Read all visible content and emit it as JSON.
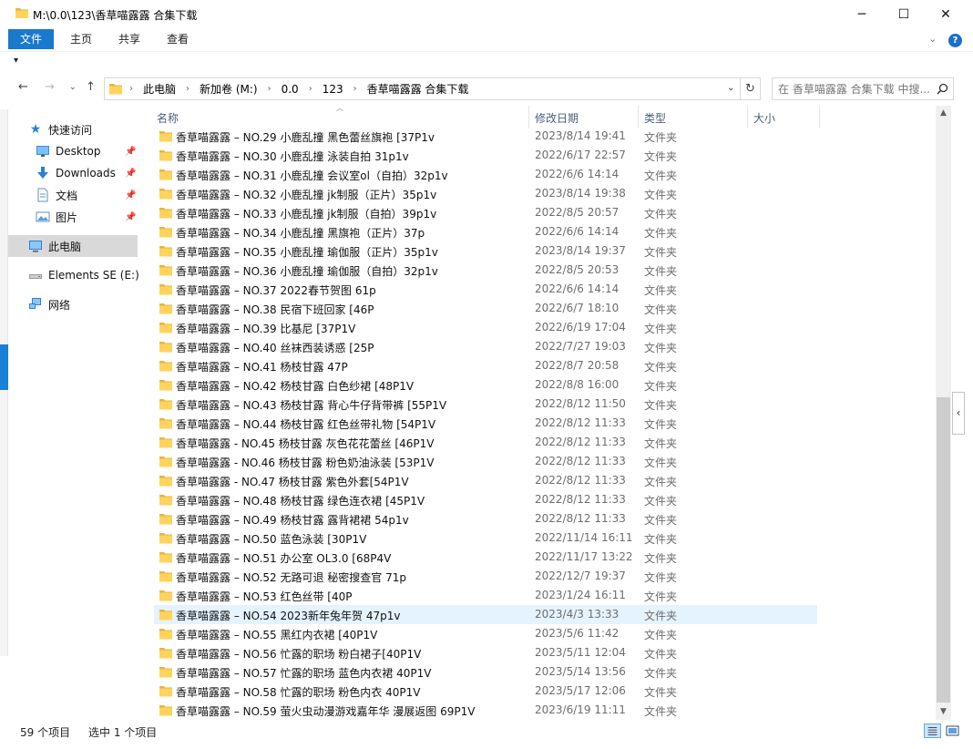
{
  "window": {
    "title": "M:\\0.0\\123\\香草喵露露 合集下载",
    "minimize_glyph": "─",
    "maximize_glyph": "☐",
    "close_glyph": "✕"
  },
  "ribbon": {
    "tabs": [
      {
        "label": "文件",
        "active": true
      },
      {
        "label": "主页",
        "active": false
      },
      {
        "label": "共享",
        "active": false
      },
      {
        "label": "查看",
        "active": false
      }
    ],
    "expand_glyph": "⌄",
    "help_glyph": "?"
  },
  "quick_access_glyph": "▾",
  "address": {
    "crumbs": [
      "此电脑",
      "新加卷 (M:)",
      "0.0",
      "123",
      "香草喵露露 合集下载"
    ],
    "separator": "›",
    "refresh_glyph": "↻",
    "dropdown_glyph": "⌄"
  },
  "search": {
    "placeholder": "在 香草喵露露 合集下载 中搜..."
  },
  "nav_buttons": {
    "back": "←",
    "forward": "→",
    "recent": "⌄",
    "up": "↑"
  },
  "nav_pane": {
    "pin_glyph": "📌",
    "items": [
      {
        "label": "快速访问",
        "icon": "star-icon",
        "indent": 0,
        "pinned": false
      },
      {
        "label": "Desktop",
        "icon": "desktop-icon",
        "indent": 1,
        "pinned": true
      },
      {
        "label": "Downloads",
        "icon": "download-icon",
        "indent": 1,
        "pinned": true
      },
      {
        "label": "文档",
        "icon": "document-icon",
        "indent": 1,
        "pinned": true
      },
      {
        "label": "图片",
        "icon": "picture-icon",
        "indent": 1,
        "pinned": true
      },
      {
        "label": "此电脑",
        "icon": "computer-icon",
        "indent": 0,
        "pinned": false,
        "selected": true
      },
      {
        "label": "Elements SE (E:)",
        "icon": "drive-icon",
        "indent": 0,
        "pinned": false
      },
      {
        "label": "网络",
        "icon": "network-icon",
        "indent": 0,
        "pinned": false
      }
    ]
  },
  "columns": {
    "name": "名称",
    "date": "修改日期",
    "type": "类型",
    "size": "大小"
  },
  "files": [
    {
      "name": "香草喵露露 – NO.29 小鹿乱撞 黑色蕾丝旗袍 [37P1v",
      "date": "2023/8/14 19:41",
      "type": "文件夹"
    },
    {
      "name": "香草喵露露 – NO.30 小鹿乱撞 泳装自拍 31p1v",
      "date": "2022/6/17 22:57",
      "type": "文件夹"
    },
    {
      "name": "香草喵露露 – NO.31 小鹿乱撞 会议室ol（自拍）32p1v",
      "date": "2022/6/6 14:14",
      "type": "文件夹"
    },
    {
      "name": "香草喵露露 – NO.32 小鹿乱撞 jk制服（正片）35p1v",
      "date": "2023/8/14 19:38",
      "type": "文件夹"
    },
    {
      "name": "香草喵露露 – NO.33 小鹿乱撞 jk制服（自拍）39p1v",
      "date": "2022/8/5 20:57",
      "type": "文件夹"
    },
    {
      "name": "香草喵露露 – NO.34 小鹿乱撞 黑旗袍（正片）37p",
      "date": "2022/6/6 14:14",
      "type": "文件夹"
    },
    {
      "name": "香草喵露露 – NO.35 小鹿乱撞 瑜伽服（正片）35p1v",
      "date": "2023/8/14 19:37",
      "type": "文件夹"
    },
    {
      "name": "香草喵露露 – NO.36 小鹿乱撞 瑜伽服（自拍）32p1v",
      "date": "2022/8/5 20:53",
      "type": "文件夹"
    },
    {
      "name": "香草喵露露 – NO.37 2022春节贺图 61p",
      "date": "2022/6/6 14:14",
      "type": "文件夹"
    },
    {
      "name": "香草喵露露 – NO.38 民宿下班回家 [46P",
      "date": "2022/6/7 18:10",
      "type": "文件夹"
    },
    {
      "name": "香草喵露露 – NO.39 比基尼 [37P1V",
      "date": "2022/6/19 17:04",
      "type": "文件夹"
    },
    {
      "name": "香草喵露露 – NO.40 丝袜西装诱惑 [25P",
      "date": "2022/7/27 19:03",
      "type": "文件夹"
    },
    {
      "name": "香草喵露露 – NO.41 杨枝甘露 47P",
      "date": "2022/8/7 20:58",
      "type": "文件夹"
    },
    {
      "name": "香草喵露露 – NO.42 杨枝甘露 白色纱裙 [48P1V",
      "date": "2022/8/8 16:00",
      "type": "文件夹"
    },
    {
      "name": "香草喵露露 – NO.43 杨枝甘露 背心牛仔背带裤 [55P1V",
      "date": "2022/8/12 11:50",
      "type": "文件夹"
    },
    {
      "name": "香草喵露露 – NO.44 杨枝甘露 红色丝带礼物 [54P1V",
      "date": "2022/8/12 11:33",
      "type": "文件夹"
    },
    {
      "name": "香草喵露露 - NO.45 杨枝甘露 灰色花花蕾丝 [46P1V",
      "date": "2022/8/12 11:33",
      "type": "文件夹"
    },
    {
      "name": "香草喵露露 - NO.46 杨枝甘露 粉色奶油泳装 [53P1V",
      "date": "2022/8/12 11:33",
      "type": "文件夹"
    },
    {
      "name": "香草喵露露 - NO.47 杨枝甘露 紫色外套[54P1V",
      "date": "2022/8/12 11:33",
      "type": "文件夹"
    },
    {
      "name": "香草喵露露 – NO.48 杨枝甘露 绿色连衣裙 [45P1V",
      "date": "2022/8/12 11:33",
      "type": "文件夹"
    },
    {
      "name": "香草喵露露 – NO.49 杨枝甘露 露背裙裙 54p1v",
      "date": "2022/8/12 11:33",
      "type": "文件夹"
    },
    {
      "name": "香草喵露露 – NO.50 蓝色泳装 [30P1V",
      "date": "2022/11/14 16:11",
      "type": "文件夹"
    },
    {
      "name": "香草喵露露 – NO.51 办公室 OL3.0 [68P4V",
      "date": "2022/11/17 13:22",
      "type": "文件夹"
    },
    {
      "name": "香草喵露露 – NO.52 无路可退 秘密搜查官 71p",
      "date": "2022/12/7 19:37",
      "type": "文件夹"
    },
    {
      "name": "香草喵露露 – NO.53 红色丝带 [40P",
      "date": "2023/1/24 16:11",
      "type": "文件夹"
    },
    {
      "name": "香草喵露露 – NO.54 2023新年兔年贺 47p1v",
      "date": "2023/4/3 13:33",
      "type": "文件夹",
      "highlighted": true
    },
    {
      "name": "香草喵露露 – NO.55 黑红内衣裙 [40P1V",
      "date": "2023/5/6 11:42",
      "type": "文件夹"
    },
    {
      "name": "香草喵露露 – NO.56 忙露的职场 粉白裙子[40P1V",
      "date": "2023/5/11 12:04",
      "type": "文件夹"
    },
    {
      "name": "香草喵露露 – NO.57 忙露的职场 蓝色内衣裙 40P1V",
      "date": "2023/5/14 13:56",
      "type": "文件夹"
    },
    {
      "name": "香草喵露露 – NO.58 忙露的职场 粉色内衣 40P1V",
      "date": "2023/5/17 12:06",
      "type": "文件夹"
    },
    {
      "name": "香草喵露露 – NO.59 萤火虫动漫游戏嘉年华 漫展返图 69P1V",
      "date": "2023/6/19 11:11",
      "type": "文件夹"
    }
  ],
  "status": {
    "count": "59 个项目",
    "selection": "选中 1 个项目"
  },
  "colors": {
    "accent": "#1979ca",
    "folder": "#ffd35c",
    "hover": "#e5f3ff",
    "header_text": "#4c607a"
  }
}
